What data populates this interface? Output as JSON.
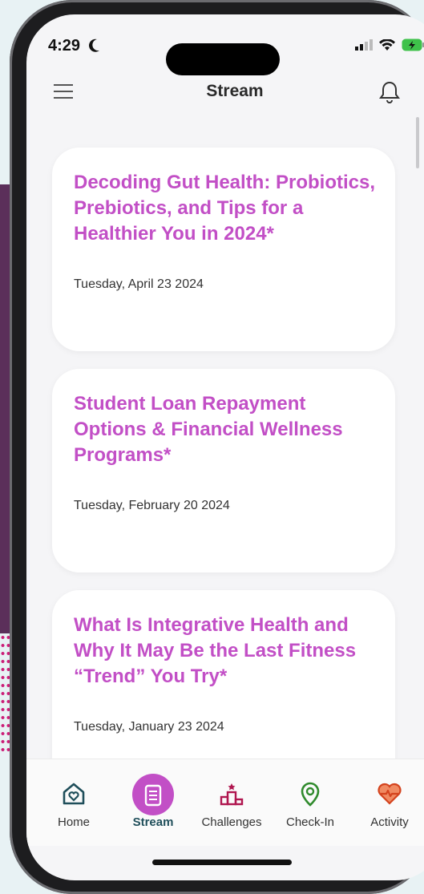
{
  "status": {
    "time": "4:29"
  },
  "header": {
    "title": "Stream"
  },
  "posts": [
    {
      "title": "Decoding Gut Health: Probiotics, Prebiotics, and Tips for a Healthier You in 2024*",
      "date": "Tuesday, April 23 2024"
    },
    {
      "title": "Student Loan Repayment Options & Financial Wellness Programs*",
      "date": "Tuesday, February 20 2024"
    },
    {
      "title": "What Is Integrative Health and Why It May Be the Last Fitness “Trend” You Try*",
      "date": "Tuesday, January 23 2024"
    }
  ],
  "tabs": [
    {
      "label": "Home",
      "icon": "home-heart-icon"
    },
    {
      "label": "Stream",
      "icon": "document-icon",
      "active": true
    },
    {
      "label": "Challenges",
      "icon": "podium-icon"
    },
    {
      "label": "Check-In",
      "icon": "location-pin-icon"
    },
    {
      "label": "Activity",
      "icon": "heart-pulse-icon"
    }
  ],
  "colors": {
    "accent": "#c24fc6",
    "background": "#f5f5f7",
    "card": "#ffffff"
  }
}
